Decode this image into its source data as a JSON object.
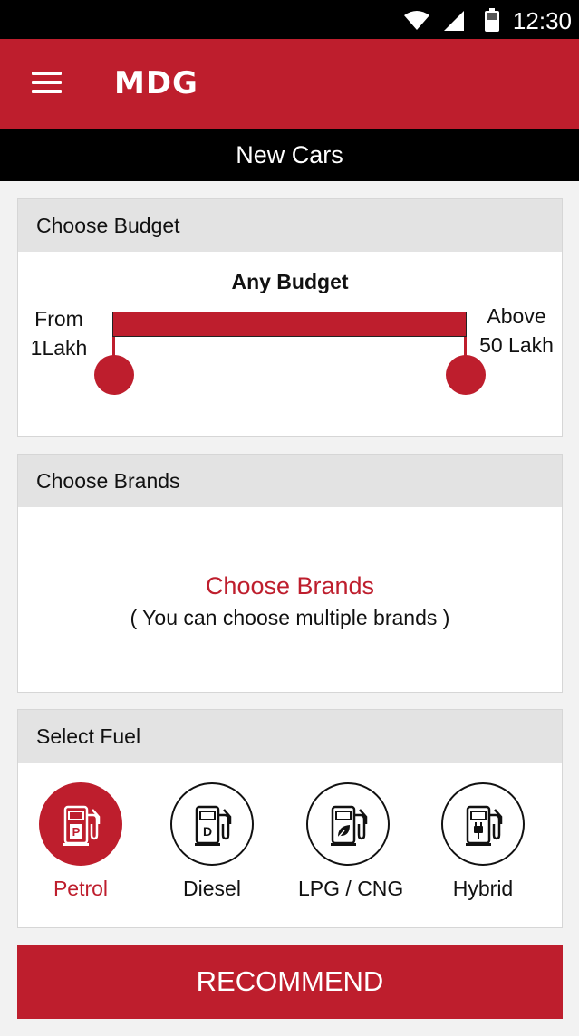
{
  "status_bar": {
    "time": "12:30",
    "icons": [
      "wifi-icon",
      "signal-icon",
      "battery-icon"
    ]
  },
  "app_bar": {
    "logo": "MDG",
    "menu_icon": "hamburger-menu-icon"
  },
  "page_title": "New Cars",
  "budget": {
    "header": "Choose Budget",
    "title": "Any Budget",
    "from_line1": "From",
    "from_line2": "1Lakh",
    "to_line1": "Above",
    "to_line2": "50 Lakh"
  },
  "brands": {
    "header": "Choose Brands",
    "link": "Choose Brands",
    "hint": "( You can choose multiple brands )"
  },
  "fuel": {
    "header": "Select Fuel",
    "options": [
      {
        "label": "Petrol",
        "icon": "fuel-pump-petrol-icon",
        "selected": true
      },
      {
        "label": "Diesel",
        "icon": "fuel-pump-diesel-icon",
        "selected": false
      },
      {
        "label": "LPG / CNG",
        "icon": "fuel-pump-leaf-icon",
        "selected": false
      },
      {
        "label": "Hybrid",
        "icon": "fuel-pump-plug-icon",
        "selected": false
      }
    ]
  },
  "recommend_button": "RECOMMEND",
  "colors": {
    "accent": "#be1e2d",
    "header_bg": "#e3e3e3",
    "page_bg": "#f2f2f2"
  }
}
